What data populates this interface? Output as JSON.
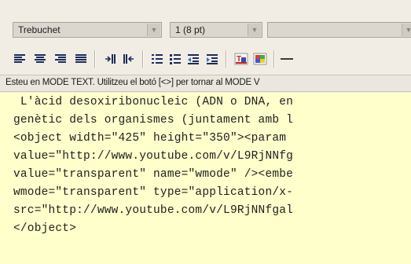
{
  "toolbar": {
    "font_family": "Trebuchet",
    "font_size": "1 (8 pt)",
    "style_value": "",
    "buttons": [
      {
        "name": "align-left-icon"
      },
      {
        "name": "align-center-icon"
      },
      {
        "name": "align-right-icon"
      },
      {
        "name": "align-justify-icon"
      },
      {
        "name": "ltr-direction-icon"
      },
      {
        "name": "rtl-direction-icon"
      },
      {
        "name": "numbered-list-icon"
      },
      {
        "name": "bullet-list-icon"
      },
      {
        "name": "outdent-icon"
      },
      {
        "name": "indent-icon"
      },
      {
        "name": "text-color-icon"
      },
      {
        "name": "background-color-icon"
      },
      {
        "name": "horizontal-rule-icon"
      }
    ]
  },
  "status_bar": {
    "message": "Esteu en MODE TEXT. Utilitzeu el botó [<>] per tornar al MODE V"
  },
  "editor": {
    "lines": [
      " L'àcid desoxiribonucleic (ADN o DNA, en",
      "genètic dels organismes (juntament amb l",
      "<object width=\"425\" height=\"350\"><param",
      "value=\"http://www.youtube.com/v/L9RjNNfg",
      "value=\"transparent\" name=\"wmode\" /><embe",
      "wmode=\"transparent\" type=\"application/x-",
      "src=\"http://www.youtube.com/v/L9RjNNfgal",
      "</object>"
    ]
  },
  "colors": {
    "editor_background": "#ffffcc",
    "toolbar_background": "#f1ede4",
    "spellcheck_underline": "#d23b3b"
  }
}
